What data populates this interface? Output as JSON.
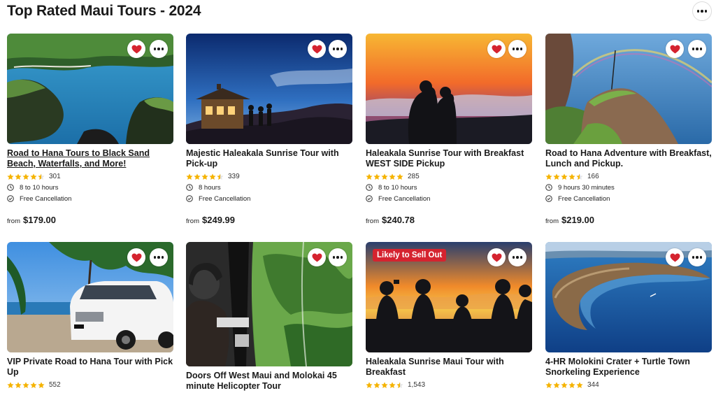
{
  "page": {
    "title": "Top Rated Maui Tours - 2024",
    "more_icon": "more-horizontal-icon"
  },
  "colors": {
    "star": "#f5b301",
    "heart": "#d5232f",
    "badge": "#d5232f"
  },
  "tours": [
    {
      "title": "Road to Hana Tours to Black Sand Beach, Waterfalls, and More!",
      "rating": 4.5,
      "reviews": "301",
      "duration": "8 to 10 hours",
      "cancellation": "Free Cancellation",
      "price_from": "from",
      "price": "$179.00",
      "favorite": true
    },
    {
      "title": "Majestic Haleakala Sunrise Tour with Pick-up",
      "rating": 4.5,
      "reviews": "339",
      "duration": "8 hours",
      "cancellation": "Free Cancellation",
      "price_from": "from",
      "price": "$249.99",
      "favorite": true
    },
    {
      "title": "Haleakala Sunrise Tour with Breakfast WEST SIDE Pickup",
      "rating": 5,
      "reviews": "285",
      "duration": "8 to 10 hours",
      "cancellation": "Free Cancellation",
      "price_from": "from",
      "price": "$240.78",
      "favorite": true
    },
    {
      "title": "Road to Hana Adventure with Breakfast, Lunch and Pickup.",
      "rating": 4.5,
      "reviews": "166",
      "duration": "9 hours 30 minutes",
      "cancellation": "Free Cancellation",
      "price_from": "from",
      "price": "$219.00",
      "favorite": true
    },
    {
      "title": "VIP Private Road to Hana Tour with Pick Up",
      "rating": 5,
      "reviews": "552",
      "favorite": true
    },
    {
      "title": "Doors Off West Maui and Molokai 45 minute Helicopter Tour",
      "favorite": true
    },
    {
      "title": "Haleakala Sunrise Maui Tour with Breakfast",
      "rating": 4.5,
      "reviews": "1,543",
      "badge": "Likely to Sell Out",
      "favorite": true
    },
    {
      "title": "4-HR Molokini Crater + Turtle Town Snorkeling Experience",
      "rating": 5,
      "reviews": "344",
      "favorite": true
    }
  ]
}
